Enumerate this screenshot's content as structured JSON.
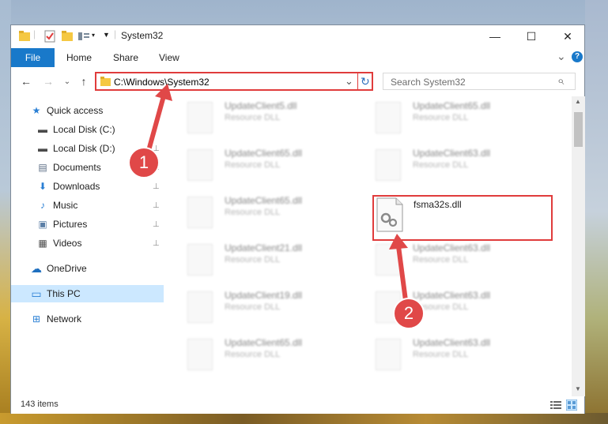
{
  "window": {
    "title": "System32",
    "controls": {
      "minimize": "—",
      "maximize": "☐",
      "close": "✕"
    }
  },
  "ribbon": {
    "file": "File",
    "tabs": [
      "Home",
      "Share",
      "View"
    ],
    "expand": "⌄",
    "help": "?"
  },
  "nav": {
    "back": "←",
    "forward": "→",
    "recent": "⌄",
    "up": "↑",
    "address": "C:\\Windows\\System32",
    "address_dropdown": "⌄",
    "refresh": "↻",
    "search_placeholder": "Search System32",
    "search_icon": "⌕"
  },
  "navpane": {
    "items": [
      {
        "label": "Quick access",
        "icon": "star-icon",
        "glyph": "★",
        "color": "#2a7fd4"
      },
      {
        "label": "Local Disk (C:)",
        "icon": "drive-icon",
        "glyph": "▬",
        "color": "#4a4a4a"
      },
      {
        "label": "Local Disk (D:)",
        "icon": "drive-icon",
        "glyph": "▬",
        "color": "#4a4a4a"
      },
      {
        "label": "Documents",
        "icon": "documents-icon",
        "glyph": "▤",
        "color": "#5b6d84"
      },
      {
        "label": "Downloads",
        "icon": "downloads-icon",
        "glyph": "⬇",
        "color": "#2a7fd4"
      },
      {
        "label": "Music",
        "icon": "music-icon",
        "glyph": "♪",
        "color": "#2a7fd4"
      },
      {
        "label": "Pictures",
        "icon": "pictures-icon",
        "glyph": "▣",
        "color": "#5b7fa6"
      },
      {
        "label": "Videos",
        "icon": "videos-icon",
        "glyph": "▦",
        "color": "#4a4a4a"
      },
      {
        "label": "OneDrive",
        "icon": "onedrive-icon",
        "glyph": "☁",
        "color": "#1e6fbf"
      },
      {
        "label": "This PC",
        "icon": "computer-icon",
        "glyph": "▭",
        "color": "#2a7fd4"
      },
      {
        "label": "Network",
        "icon": "network-icon",
        "glyph": "⊞",
        "color": "#2a7fd4"
      }
    ],
    "pin_glyph": "📌"
  },
  "files": {
    "left": [
      {
        "name": "UpdateClient5.dll",
        "type": "Resource DLL"
      },
      {
        "name": "UpdateClient65.dll",
        "type": "Resource DLL"
      },
      {
        "name": "UpdateClient65.dll",
        "type": "Resource DLL"
      },
      {
        "name": "UpdateClient21.dll",
        "type": "Resource DLL"
      },
      {
        "name": "UpdateClient19.dll",
        "type": "Resource DLL"
      },
      {
        "name": "UpdateClient65.dll",
        "type": "Resource DLL"
      }
    ],
    "right": [
      {
        "name": "UpdateClient65.dll",
        "type": "Resource DLL"
      },
      {
        "name": "UpdateClient63.dll",
        "type": "Resource DLL"
      },
      {
        "name": "fsma32s.dll",
        "type": ""
      },
      {
        "name": "UpdateClient63.dll",
        "type": "Resource DLL"
      },
      {
        "name": "UpdateClient63.dll",
        "type": "Resource DLL"
      },
      {
        "name": "UpdateClient63.dll",
        "type": "Resource DLL"
      }
    ]
  },
  "status": {
    "items": "143 items"
  },
  "annotations": {
    "badge1": "1",
    "badge2": "2",
    "color": "#e04848"
  }
}
